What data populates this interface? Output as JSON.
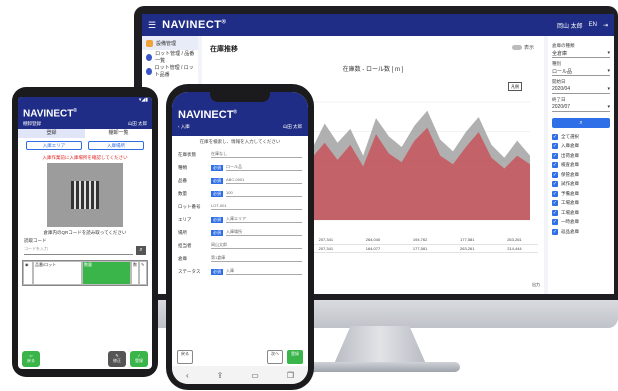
{
  "desktop": {
    "brand": "NAVINECT",
    "header_right": [
      "岡山 太郎",
      "EN",
      "⇥"
    ],
    "nav": [
      {
        "label": "設備管理"
      },
      {
        "label": "ロット管理 / 品番一覧"
      },
      {
        "label": "ロット管理 / ロット品番"
      }
    ],
    "page_title": "在庫推移",
    "toggle_label": "表示",
    "chart_title": "在庫数 - ロール数 [ m ]",
    "legend_label": "凡例",
    "table_rows": [
      [
        "164,120",
        "203,223",
        "207,341",
        "264,040",
        "194,762",
        "177,581",
        "263,261"
      ],
      [
        "164,040",
        "194,040",
        "207,341",
        "164,077",
        "177,581",
        "263,261",
        "214,444"
      ]
    ],
    "export_label": "出力",
    "filters": [
      {
        "label": "倉庫の種類",
        "value": "全倉庫"
      },
      {
        "label": "種別",
        "value": "ロール品"
      },
      {
        "label": "開始日",
        "value": "2020/04"
      },
      {
        "label": "終了日",
        "value": "2020/07"
      }
    ],
    "search_label": "検索",
    "checks": [
      "全て選択",
      "入庫倉庫",
      "出荷倉庫",
      "検査倉庫",
      "保管倉庫",
      "試作倉庫",
      "予備倉庫",
      "工場倉庫",
      "工場倉庫",
      "一時倉庫",
      "返品倉庫"
    ],
    "colors": {
      "header": "#1f2d86",
      "accent": "#2e6ee6",
      "series_red": "#c94a52",
      "series_gray": "#8f8f8f"
    }
  },
  "android": {
    "brand": "NAVINECT",
    "left_sub": "棚卸登録",
    "right_sub": "山田 太郎",
    "tabs": [
      "登録",
      "棚卸一覧"
    ],
    "buttons": [
      "入庫エリア",
      "入庫場所"
    ],
    "warning": "入庫作業前に入庫場所を確認してください",
    "caption": "倉庫内のQRコードを読み取ってください",
    "input_label": "読取コード",
    "input_placeholder": "コードを入力",
    "grid": [
      "品番/ロット",
      "数量",
      "ロット番号",
      "数",
      "数"
    ],
    "footer": [
      "戻る",
      "修正",
      "登録"
    ]
  },
  "iphone": {
    "brand": "NAVINECT",
    "left_sub": "入庫",
    "right_sub": "山田 太郎",
    "hint": "在庫を検索し、情報を入力してください",
    "rows": [
      {
        "label": "在庫状態",
        "tag": "",
        "value": "在庫なし"
      },
      {
        "label": "種類",
        "tag": "必須",
        "value": "ロール品"
      },
      {
        "label": "品番",
        "tag": "必須",
        "value": "ABC-0001"
      },
      {
        "label": "数量",
        "tag": "必須",
        "value": "100"
      },
      {
        "label": "ロット番号",
        "tag": "",
        "value": "LOT-001"
      },
      {
        "label": "エリア",
        "tag": "必須",
        "value": "入庫エリア"
      },
      {
        "label": "場所",
        "tag": "必須",
        "value": "入庫場所"
      },
      {
        "label": "担当者",
        "tag": "",
        "value": "岡山太郎"
      },
      {
        "label": "倉庫",
        "tag": "",
        "value": "第1倉庫"
      },
      {
        "label": "ステータス",
        "tag": "必須",
        "value": "入庫"
      }
    ],
    "footer": [
      "戻る",
      "次へ",
      "登録"
    ]
  },
  "chart_data": {
    "type": "area",
    "title": "在庫数 - ロール数 [ m ]",
    "series": [
      {
        "values": [
          42,
          55,
          48,
          70,
          62,
          80,
          58,
          66,
          90,
          72,
          85,
          60,
          95,
          78,
          68,
          88,
          102,
          75,
          64,
          82,
          96,
          70,
          58,
          74,
          60
        ]
      },
      {
        "values": [
          30,
          44,
          38,
          52,
          50,
          64,
          46,
          58,
          72,
          56,
          70,
          50,
          80,
          62,
          54,
          74,
          86,
          60,
          52,
          68,
          82,
          58,
          48,
          60,
          52
        ]
      }
    ],
    "ylim": [
      0,
      110
    ]
  }
}
